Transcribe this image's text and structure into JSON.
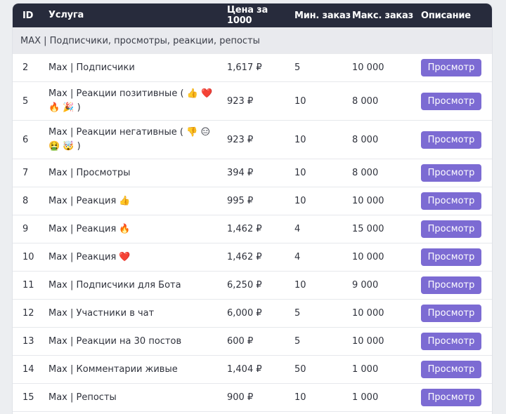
{
  "header": {
    "id": "ID",
    "service": "Услуга",
    "price": "Цена за 1000",
    "min": "Мин. заказ",
    "max": "Макс. заказ",
    "desc": "Описание"
  },
  "category": "MAX | Подписчики, просмотры, реакции, репосты",
  "button_label": "Просмотр",
  "colors": {
    "header_bg": "#272b3c",
    "category_bg": "#e9eaee",
    "button_bg": "#7c6bd3"
  },
  "rows": [
    {
      "id": "2",
      "service": "Max | Подписчики",
      "price": "1,617 ₽",
      "min": "5",
      "max": "10 000"
    },
    {
      "id": "5",
      "service": "Max | Реакции позитивные ( 👍 ❤️ 🔥 🎉 )",
      "price": "923 ₽",
      "min": "10",
      "max": "8 000"
    },
    {
      "id": "6",
      "service": "Max | Реакции негативные ( 👎 😑 🤮 🤯 )",
      "price": "923 ₽",
      "min": "10",
      "max": "8 000"
    },
    {
      "id": "7",
      "service": "Max | Просмотры",
      "price": "394 ₽",
      "min": "10",
      "max": "8 000"
    },
    {
      "id": "8",
      "service": "Max | Реакция 👍",
      "price": "995 ₽",
      "min": "10",
      "max": "10 000"
    },
    {
      "id": "9",
      "service": "Max | Реакция 🔥",
      "price": "1,462 ₽",
      "min": "4",
      "max": "15 000"
    },
    {
      "id": "10",
      "service": "Max | Реакция ❤️",
      "price": "1,462 ₽",
      "min": "4",
      "max": "10 000"
    },
    {
      "id": "11",
      "service": "Max | Подписчики для Бота",
      "price": "6,250 ₽",
      "min": "10",
      "max": "9 000"
    },
    {
      "id": "12",
      "service": "Max | Участники в чат",
      "price": "6,000 ₽",
      "min": "5",
      "max": "10 000"
    },
    {
      "id": "13",
      "service": "Max | Реакции на 30 постов",
      "price": "600 ₽",
      "min": "5",
      "max": "10 000"
    },
    {
      "id": "14",
      "service": "Max | Комментарии живые",
      "price": "1,404 ₽",
      "min": "50",
      "max": "1 000"
    },
    {
      "id": "15",
      "service": "Max | Репосты",
      "price": "900 ₽",
      "min": "10",
      "max": "1 000"
    }
  ]
}
